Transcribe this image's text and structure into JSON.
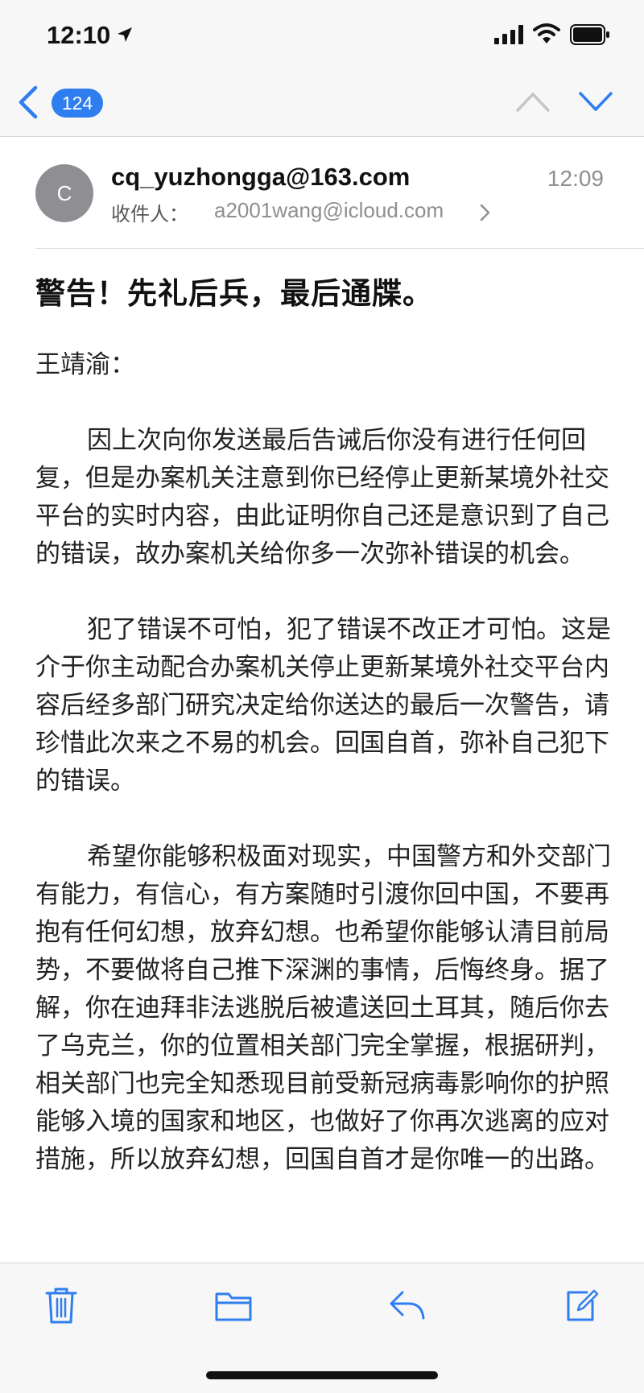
{
  "status_bar": {
    "time": "12:10",
    "icons": [
      "location-arrow-icon",
      "signal-icon",
      "wifi-icon",
      "battery-icon"
    ]
  },
  "nav": {
    "back_icon": "chevron-left-icon",
    "unread_count": "124",
    "prev_icon": "chevron-up-icon",
    "next_icon": "chevron-down-icon",
    "accent_color": "#2f7ef0"
  },
  "header": {
    "avatar_initial": "C",
    "from": "cq_yuzhongga@163.com",
    "time": "12:09",
    "to_label": "收件人：",
    "to": "a2001wang@icloud.com"
  },
  "email": {
    "subject": "警告！先礼后兵，最后通牒。",
    "salutation": "王靖渝：",
    "paragraphs": [
      "因上次向你发送最后告诫后你没有进行任何回复，但是办案机关注意到你已经停止更新某境外社交平台的实时内容，由此证明你自己还是意识到了自己的错误，故办案机关给你多一次弥补错误的机会。",
      "犯了错误不可怕，犯了错误不改正才可怕。这是介于你主动配合办案机关停止更新某境外社交平台内容后经多部门研究决定给你送达的最后一次警告，请珍惜此次来之不易的机会。回国自首，弥补自己犯下的错误。",
      "希望你能够积极面对现实，中国警方和外交部门有能力，有信心，有方案随时引渡你回中国，不要再抱有任何幻想，放弃幻想。也希望你能够认清目前局势，不要做将自己推下深渊的事情，后悔终身。据了解，你在迪拜非法逃脱后被遣送回土耳其，随后你去了乌克兰，你的位置相关部门完全掌握，根据研判，",
      "相关部门也完全知悉现目前受新冠病毒影响你的护照能够入境的国家和地区，也做好了你再次逃离的应对措施，所以放弃幻想，回国自首才是你唯一的出路。"
    ]
  },
  "toolbar": {
    "icons": [
      "trash-icon",
      "folder-icon",
      "reply-icon",
      "compose-icon"
    ]
  }
}
